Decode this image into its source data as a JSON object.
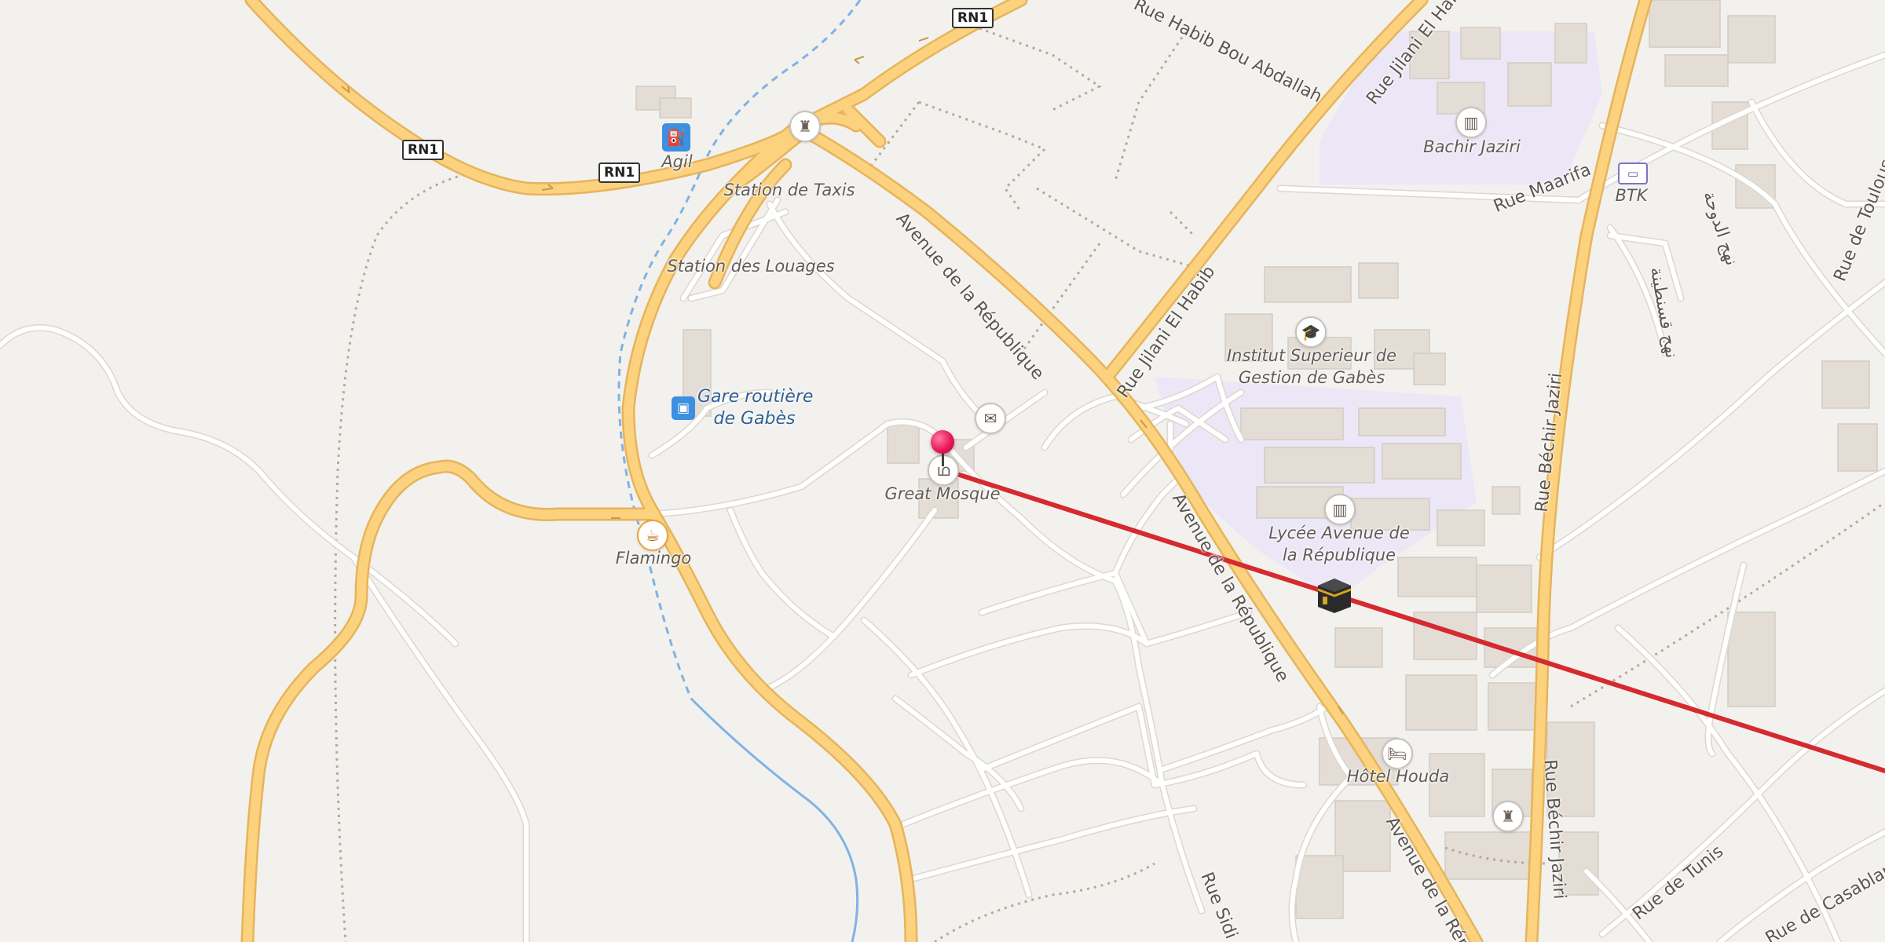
{
  "map": {
    "place_labels": {
      "agil": "Agil",
      "station_taxis": "Station de Taxis",
      "station_louages": "Station des Louages",
      "gare_routiere_l1": "Gare routière",
      "gare_routiere_l2": "de Gabès",
      "great_mosque": "Great Mosque",
      "flamingo": "Flamingo",
      "bachir_jaziri": "Bachir Jaziri",
      "btk": "BTK",
      "institut_l1": "Institut Superieur de",
      "institut_l2": "Gestion de Gabès",
      "lycee_l1": "Lycée Avenue de",
      "lycee_l2": "la République",
      "hotel_houda": "Hôtel Houda"
    },
    "street_labels": {
      "habib_bou_abdallah": "Rue Habib Bou Abdallah",
      "jilani_el_habib_top": "Rue Jilani El Habib",
      "jilani_el_habib_mid": "Rue Jilani El Habib",
      "avenue_rep_1": "Avenue de la République",
      "avenue_rep_2": "Avenue de la République",
      "avenue_rep_3": "Avenue de la Rép",
      "rue_maarifa": "Rue Maarifa",
      "rue_bechir_jaziri_1": "Rue Béchir Jaziri",
      "rue_bechir_jaziri_2": "Rue Béchir Jaziri",
      "rue_de_toulouse": "Rue de Toulouse",
      "rue_de_tunis": "Rue de Tunis",
      "rue_de_casablanca": "Rue de Casablan",
      "rue_sidi": "Rue Sidi",
      "arabic_1": "نهج الدوحة",
      "arabic_2": "نهج قسنطينة"
    },
    "route_shields": [
      "RN1",
      "RN1",
      "RN1"
    ],
    "colors": {
      "background": "#f3f1ed",
      "major_road": "#fcd27e",
      "major_road_casing": "#e6b45c",
      "minor_road": "#ffffff",
      "minor_road_casing": "#dcd7d1",
      "campus": "#ebe7f6",
      "building": "#e3ddd6",
      "waterway": "#7fb2e5",
      "route_line": "#d42a30",
      "pin": "#e8195a"
    },
    "icons": {
      "fuel": "fuel-pump-icon",
      "monument": "monument-icon",
      "bus": "bus-icon",
      "post": "envelope-icon",
      "mosque": "mosque-icon",
      "cafe": "coffee-cup-icon",
      "school": "school-icon",
      "university": "graduation-cap-icon",
      "bank": "bank-note-icon",
      "hotel": "bed-icon",
      "kaaba": "kaaba-icon",
      "pin": "location-pin-icon"
    }
  }
}
